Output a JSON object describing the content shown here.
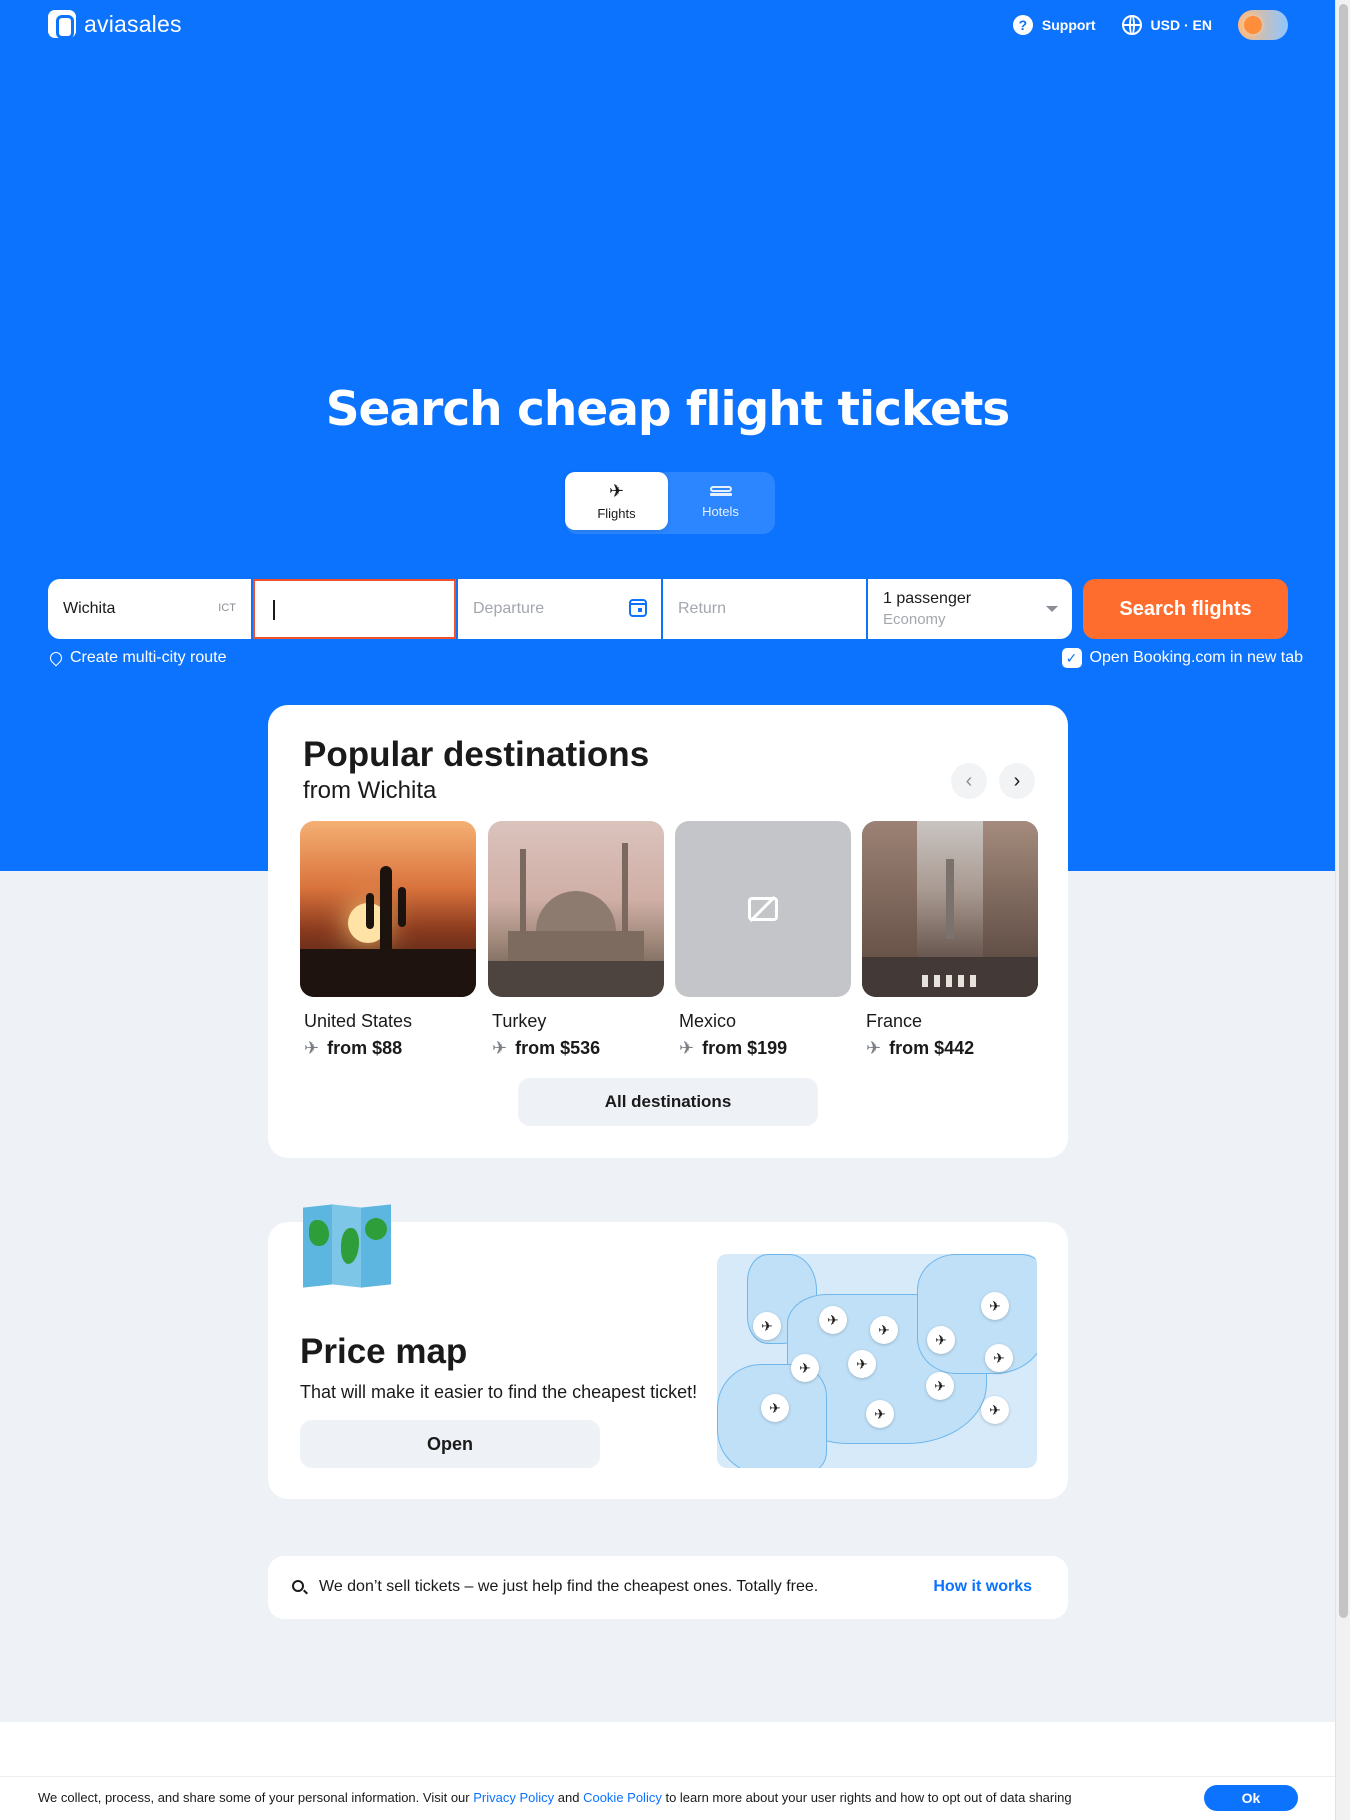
{
  "header": {
    "logo_text": "aviasales",
    "support_label": "Support",
    "currency_language": "USD · EN"
  },
  "hero": {
    "title": "Search cheap flight tickets",
    "tabs": [
      {
        "label": "Flights",
        "icon": "plane-icon",
        "active": true
      },
      {
        "label": "Hotels",
        "icon": "bed-icon",
        "active": false
      }
    ]
  },
  "search": {
    "origin": {
      "value": "Wichita",
      "code": "ICT"
    },
    "destination": {
      "value": ""
    },
    "departure": {
      "placeholder": "Departure"
    },
    "return": {
      "placeholder": "Return"
    },
    "passengers": {
      "count_label": "1 passenger",
      "class_label": "Economy"
    },
    "submit_label": "Search flights",
    "multi_city_label": "Create multi-city route",
    "open_booking_label": "Open Booking.com in new tab",
    "open_booking_checked": true
  },
  "popular": {
    "title": "Popular destinations",
    "subtitle": "from Wichita",
    "destinations": [
      {
        "country": "United States",
        "price": "from $88"
      },
      {
        "country": "Turkey",
        "price": "from $536"
      },
      {
        "country": "Mexico",
        "price": "from $199"
      },
      {
        "country": "France",
        "price": "from $442"
      }
    ],
    "all_label": "All destinations"
  },
  "price_map": {
    "title": "Price map",
    "subtitle": "That will make it easier to find the cheapest ticket!",
    "open_label": "Open"
  },
  "info": {
    "text": "We don’t sell tickets – we just help find the cheapest ones. Totally free.",
    "link_label": "How it works"
  },
  "cookie": {
    "text_before": "We collect, process, and share some of your personal information. Visit our ",
    "privacy_link": "Privacy Policy",
    "and": " and ",
    "cookie_link": "Cookie Policy",
    "text_after": " to learn more about your user rights and how to opt out of data sharing",
    "ok_label": "Ok"
  },
  "colors": {
    "brand_blue": "#0c73fe",
    "accent_orange": "#ff6d2e",
    "focus_red": "#f0522c"
  }
}
